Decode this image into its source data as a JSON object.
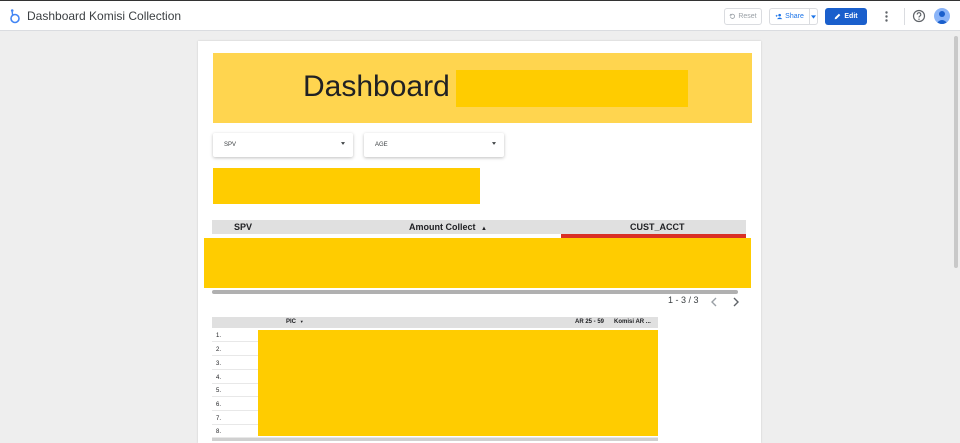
{
  "app": {
    "title": "Dashboard Komisi Collection"
  },
  "toolbar": {
    "reset_label": "Reset",
    "share_label": "Share",
    "edit_label": "Edit"
  },
  "report": {
    "banner_title": "Dashboard",
    "filters": [
      {
        "label": "SPV"
      },
      {
        "label": "AGE"
      }
    ],
    "table1": {
      "columns": [
        "SPV",
        "Amount Collect",
        "CUST_ACCT"
      ],
      "sort_indicator": "▲",
      "pagination": "1 - 3 / 3"
    },
    "table2": {
      "columns": [
        "PIC",
        "AR 25 - 59",
        "Komisi AR ..."
      ],
      "sort_indicator": "▼",
      "row_numbers": [
        "1.",
        "2.",
        "3.",
        "4.",
        "5.",
        "6.",
        "7.",
        "8."
      ]
    }
  },
  "colors": {
    "accent_blue": "#1a5fcc",
    "banner_yellow": "#ffd54f",
    "redaction_yellow": "#ffcc00",
    "bar_red": "#d93025"
  },
  "icons": [
    "looker-studio-logo-icon",
    "reset-icon",
    "add-person-icon",
    "caret-down-icon",
    "pencil-icon",
    "more-vert-icon",
    "help-icon",
    "avatar-icon",
    "chevron-left-icon",
    "chevron-right-icon"
  ]
}
